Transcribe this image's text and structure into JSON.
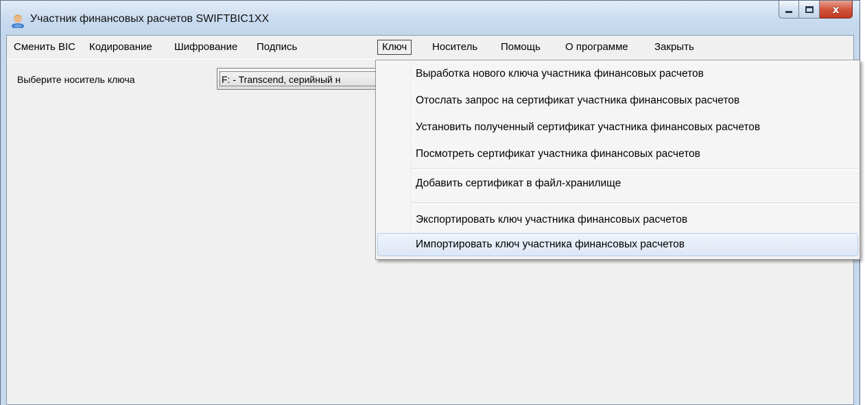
{
  "window": {
    "title": "Участник финансовых расчетов SWIFTBIC1XX",
    "close_symbol": "x"
  },
  "menu": {
    "items": [
      {
        "label": "Сменить BIC"
      },
      {
        "label": "Кодирование"
      },
      {
        "label": "Шифрование"
      },
      {
        "label": "Подпись"
      },
      {
        "label": "Ключ"
      },
      {
        "label": "Носитель"
      },
      {
        "label": "Помощь"
      },
      {
        "label": "О программе"
      },
      {
        "label": "Закрыть"
      }
    ],
    "active_label": "Ключ"
  },
  "form": {
    "key_media_label": "Выберите носитель ключа",
    "key_media_value": "F: - Transcend, серийный н"
  },
  "key_menu": {
    "items": [
      {
        "label": "Выработка нового ключа участника финансовых расчетов"
      },
      {
        "label": "Отослать запрос на сертификат участника финансовых расчетов"
      },
      {
        "label": "Установить полученный сертификат участника финансовых расчетов"
      },
      {
        "label": "Посмотреть сертификат участника финансовых расчетов"
      },
      {
        "label": "Добавить сертификат в файл-хранилище"
      },
      {
        "label": "Экспортировать ключ участника финансовых расчетов"
      },
      {
        "label": "Импортировать ключ участника финансовых расчетов"
      }
    ],
    "highlighted_label": "Импортировать ключ участника финансовых расчетов"
  },
  "colors": {
    "window_frame": "#c6d8ec",
    "close_button": "#c23a21",
    "menu_highlight": "#dce7f5"
  }
}
